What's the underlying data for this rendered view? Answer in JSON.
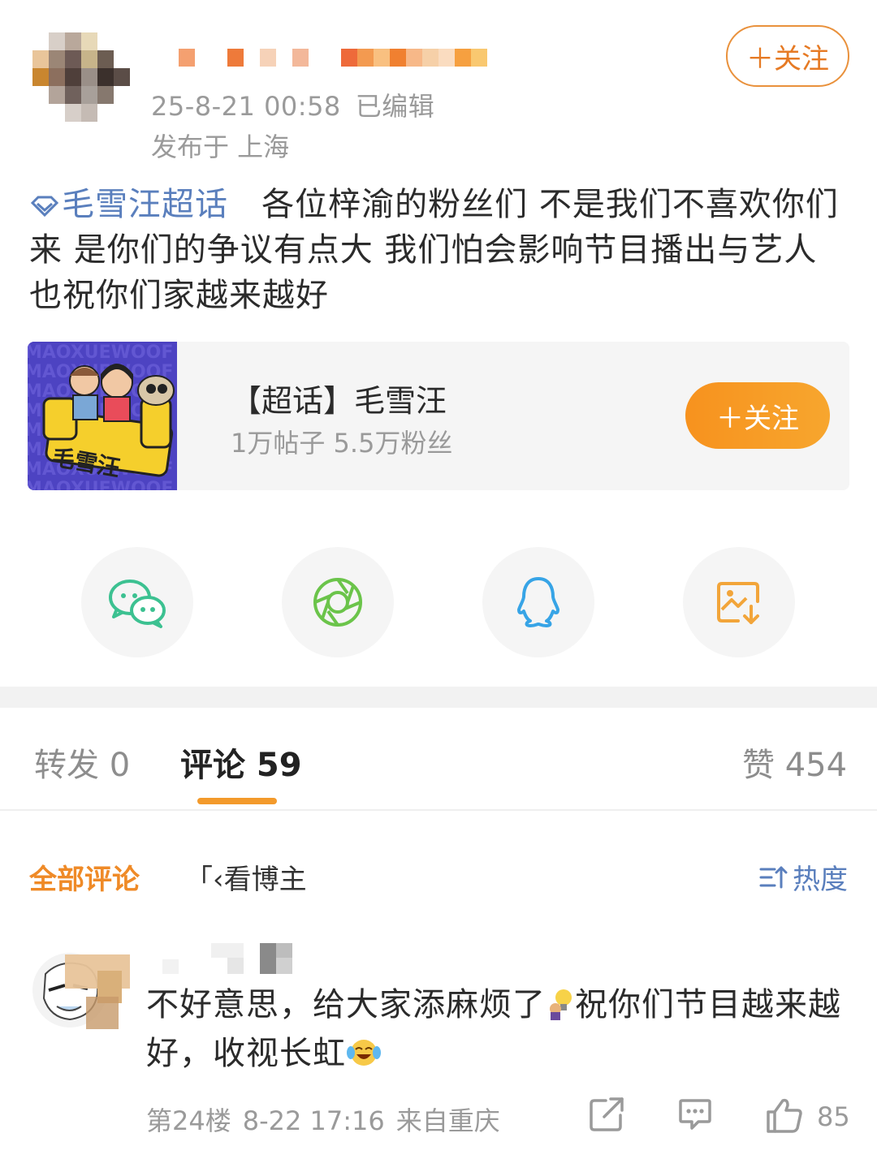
{
  "post": {
    "time": "25-8-21 00:58",
    "edited": "已编辑",
    "location": "发布于 上海",
    "follow_label": "＋关注",
    "topic_tag": "毛雪汪超话",
    "text": "各位梓渝的粉丝们 不是我们不喜欢你们来 是你们的争议有点大 我们怕会影响节目播出与艺人 也祝你们家越来越好"
  },
  "topic_card": {
    "title": "【超话】毛雪汪",
    "stats": "1万帖子 5.5万粉丝",
    "follow_label": "＋关注",
    "image_text": "毛雪汪"
  },
  "share": {
    "items": [
      {
        "icon": "wechat-icon",
        "color": "#3cc191"
      },
      {
        "icon": "moments-icon",
        "color": "#6bc44a"
      },
      {
        "icon": "qq-icon",
        "color": "#37a4e6"
      },
      {
        "icon": "save-image-icon",
        "color": "#f2a53a"
      }
    ]
  },
  "tabs": {
    "repost": "转发 0",
    "comments": "评论 59",
    "likes": "赞 454"
  },
  "filters": {
    "all": "全部评论",
    "owner": "「‹看博主",
    "sort": "热度"
  },
  "comment": {
    "text_part1": "不好意思，给大家添麻烦了",
    "text_part2": "祝你们节目越来越好，收视长虹",
    "floor": "第24楼",
    "time": "8-22 17:16",
    "from": "来自重庆",
    "likes": "85"
  },
  "colors": {
    "accent": "#ef8a27",
    "link": "#5a7fbd",
    "muted": "#9a9a9a"
  }
}
